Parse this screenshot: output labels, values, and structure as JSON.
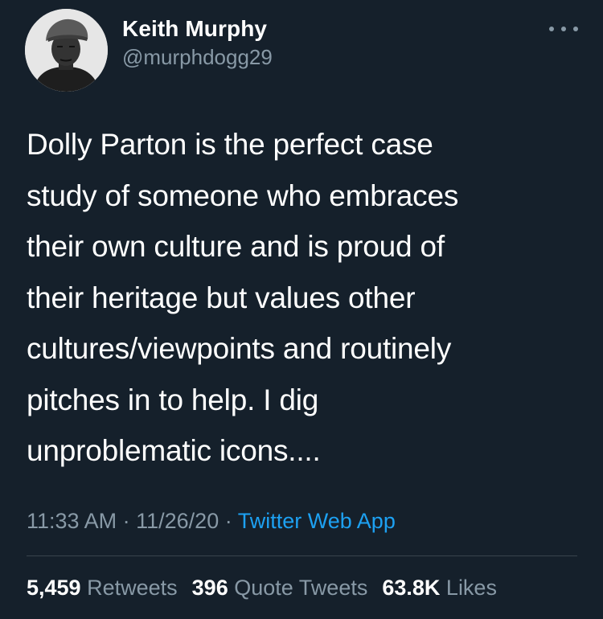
{
  "author": {
    "name": "Keith Murphy",
    "handle": "@murphdogg29"
  },
  "tweet": {
    "lines": [
      "Dolly Parton is the perfect case",
      "study of someone who embraces",
      "their own culture and is proud of",
      "their heritage but values other",
      "cultures/viewpoints and routinely",
      "pitches in to help. I dig",
      "unproblematic icons...."
    ]
  },
  "meta": {
    "time": "11:33 AM",
    "separator": "·",
    "date": "11/26/20",
    "source": "Twitter Web App"
  },
  "stats": {
    "retweets_count": "5,459",
    "retweets_label": "Retweets",
    "quotes_count": "396",
    "quotes_label": "Quote Tweets",
    "likes_count": "63.8K",
    "likes_label": "Likes"
  },
  "icons": {
    "more": "more-horizontal-icon",
    "avatar": "profile-photo"
  },
  "colors": {
    "background": "#15202b",
    "primary_text": "#ffffff",
    "secondary_text": "#8899a6",
    "link": "#1da1f2",
    "divider": "#38444d"
  }
}
